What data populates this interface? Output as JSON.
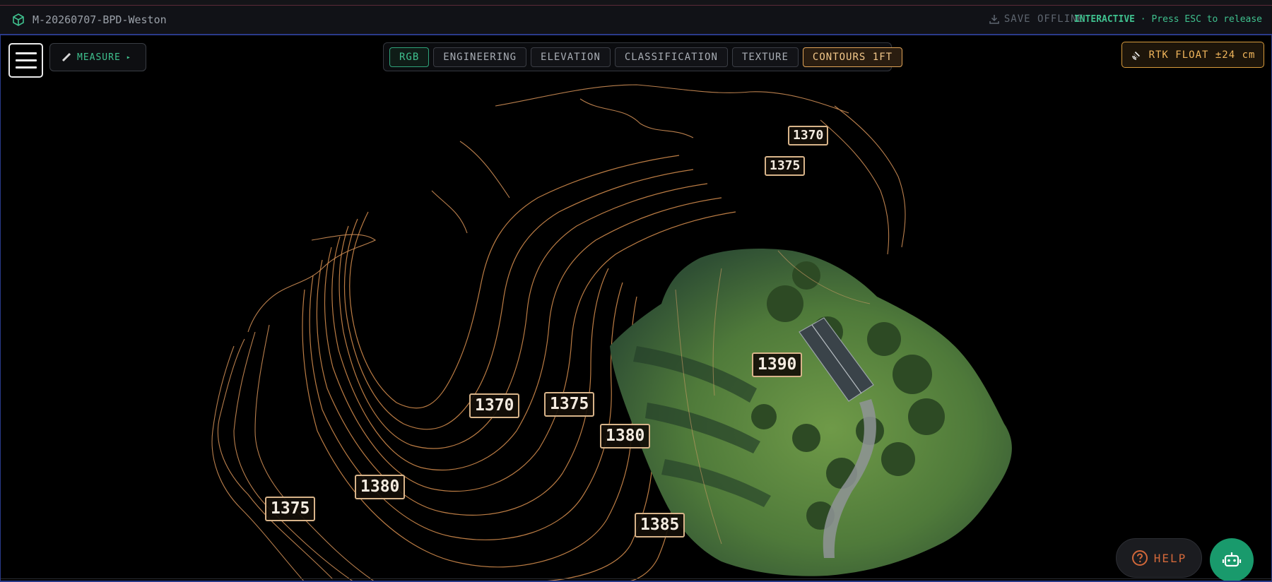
{
  "titlebar": {
    "mission_name": "M-20260707-BPD-Weston",
    "save_offline": "SAVE OFFLINE",
    "mode_label": "INTERACTIVE",
    "mode_hint": " · Press ESC to release"
  },
  "toolbar": {
    "measure_label": "MEASURE",
    "measure_caret": "▸"
  },
  "layers": {
    "tabs": [
      {
        "label": "RGB"
      },
      {
        "label": "ENGINEERING"
      },
      {
        "label": "ELEVATION"
      },
      {
        "label": "CLASSIFICATION"
      },
      {
        "label": "TEXTURE"
      },
      {
        "label": "CONTOURS 1FT"
      }
    ]
  },
  "gps": {
    "status": "RTK FLOAT ±24 cm"
  },
  "contour_labels": [
    "1370",
    "1375",
    "1390",
    "1370",
    "1375",
    "1380",
    "1380",
    "1375",
    "1385"
  ],
  "help": {
    "label": "HELP"
  },
  "colors": {
    "accent_green": "#3fc08e",
    "contour_orange": "#e0a063",
    "rtk_amber": "#f0b55b",
    "help_orange": "#d2683a"
  }
}
